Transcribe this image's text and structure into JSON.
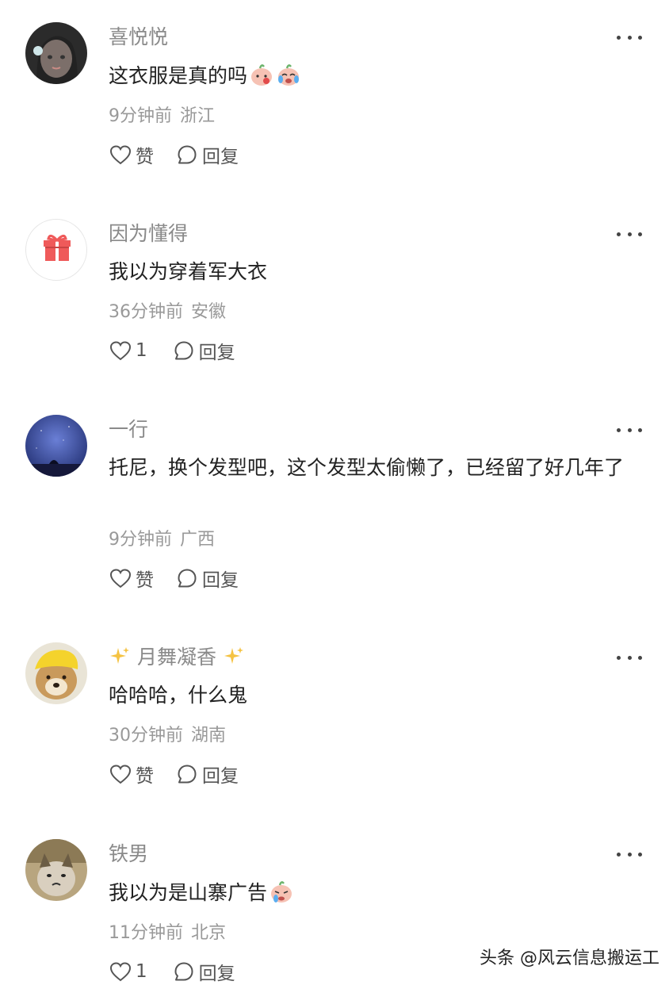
{
  "comments": [
    {
      "user": "喜悦悦",
      "text": "这衣服是真的吗",
      "time": "9分钟前",
      "location": "浙江",
      "like_label": "赞",
      "reply_label": "回复"
    },
    {
      "user": "因为懂得",
      "text": "我以为穿着军大衣",
      "time": "36分钟前",
      "location": "安徽",
      "like_label": "1",
      "reply_label": "回复"
    },
    {
      "user": "一行",
      "text": "托尼，换个发型吧，这个发型太偷懒了，已经留了好几年了",
      "time": "9分钟前",
      "location": "广西",
      "like_label": "赞",
      "reply_label": "回复"
    },
    {
      "user": "月舞凝香",
      "text": "哈哈哈，什么鬼",
      "time": "30分钟前",
      "location": "湖南",
      "like_label": "赞",
      "reply_label": "回复"
    },
    {
      "user": "铁男",
      "text": "我以为是山寨广告",
      "time": "11分钟前",
      "location": "北京",
      "like_label": "1",
      "reply_label": "回复"
    }
  ],
  "watermark": "头条 @风云信息搬运工",
  "icons": {
    "like": "heart-outline-icon",
    "reply": "speech-bubble-icon",
    "more": "more-dots-icon",
    "sparkle": "sparkle-icon"
  },
  "colors": {
    "username": "#8a8a8a",
    "text": "#222222",
    "meta": "#999999",
    "action": "#555555"
  }
}
